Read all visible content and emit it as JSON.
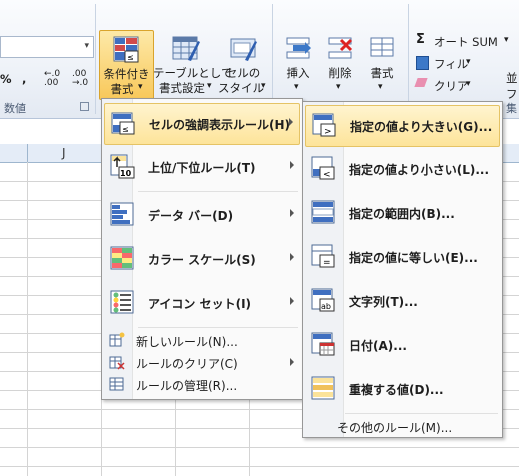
{
  "ribbon": {
    "number_group": {
      "label": "数値",
      "percent": "%",
      "comma": ",",
      "inc_decimal": "←.0 .00",
      "dec_decimal": ".00 →.0"
    },
    "styles_group": {
      "conditional_formatting": {
        "line1": "条件付き",
        "line2": "書式"
      },
      "format_as_table": {
        "line1": "テーブルとして",
        "line2": "書式設定"
      },
      "cell_styles": {
        "line1": "セルの",
        "line2": "スタイル"
      }
    },
    "cells_group": {
      "insert": "挿入",
      "delete": "削除",
      "format": "書式"
    },
    "editing_group": {
      "autosum": "オート SUM",
      "fill": "フィル",
      "clear": "クリア",
      "sort_line1": "並",
      "sort_line2": "フ",
      "label_fragment": "集"
    }
  },
  "sheet": {
    "column_label": "J"
  },
  "main_menu": {
    "items": [
      {
        "label": "セルの強調表示ルール(H)",
        "has_submenu": true,
        "selected": true,
        "icon": "highlight-cells-rules-icon"
      },
      {
        "label": "上位/下位ルール(T)",
        "has_submenu": true,
        "selected": false,
        "icon": "top-bottom-rules-icon"
      },
      {
        "label": "データ バー(D)",
        "has_submenu": true,
        "selected": false,
        "icon": "data-bars-icon"
      },
      {
        "label": "カラー スケール(S)",
        "has_submenu": true,
        "selected": false,
        "icon": "color-scales-icon"
      },
      {
        "label": "アイコン セット(I)",
        "has_submenu": true,
        "selected": false,
        "icon": "icon-sets-icon"
      }
    ],
    "small_items": [
      {
        "label": "新しいルール(N)...",
        "has_submenu": false,
        "icon": "new-rule-icon"
      },
      {
        "label": "ルールのクリア(C)",
        "has_submenu": true,
        "icon": "clear-rules-icon"
      },
      {
        "label": "ルールの管理(R)...",
        "has_submenu": false,
        "icon": "manage-rules-icon"
      }
    ]
  },
  "sub_menu": {
    "items": [
      {
        "label": "指定の値より大きい(G)...",
        "selected": true,
        "icon": "greater-than-icon"
      },
      {
        "label": "指定の値より小さい(L)...",
        "selected": false,
        "icon": "less-than-icon"
      },
      {
        "label": "指定の範囲内(B)...",
        "selected": false,
        "icon": "between-icon"
      },
      {
        "label": "指定の値に等しい(E)...",
        "selected": false,
        "icon": "equal-to-icon"
      },
      {
        "label": "文字列(T)...",
        "selected": false,
        "icon": "text-contains-icon"
      },
      {
        "label": "日付(A)...",
        "selected": false,
        "icon": "date-occurring-icon"
      },
      {
        "label": "重複する値(D)...",
        "selected": false,
        "icon": "duplicate-values-icon"
      }
    ],
    "footer": "その他のルール(M)..."
  }
}
